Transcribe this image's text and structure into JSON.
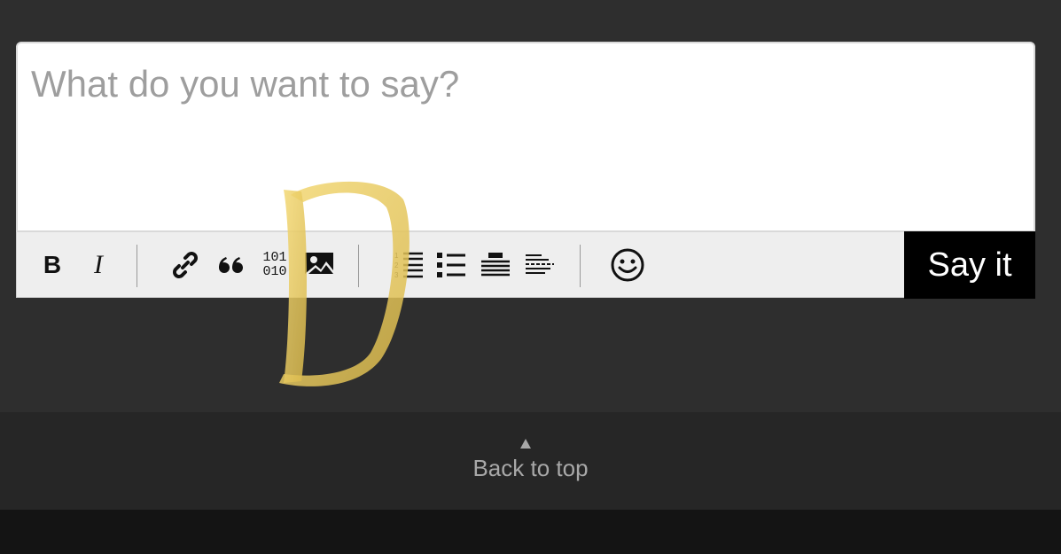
{
  "composer": {
    "placeholder": "What do you want to say?",
    "value": "",
    "submit_label": "Say it"
  },
  "toolbar": {
    "bold_glyph": "B",
    "italic_glyph": "I",
    "code_glyph_top": "101",
    "code_glyph_bottom": "010",
    "icons": [
      "bold-icon",
      "italic-icon",
      "link-icon",
      "quote-icon",
      "code-icon",
      "image-icon",
      "numbered-list-icon",
      "bullet-list-icon",
      "heading-icon",
      "horizontal-rule-icon",
      "emoji-icon"
    ]
  },
  "footer": {
    "back_to_top_label": "Back to top"
  },
  "colors": {
    "page_background": "#2e2e2e",
    "footer_background": "#262626",
    "bottom_bar": "#141414",
    "submit_background": "#000000",
    "toolbar_background": "#eeeeee",
    "watermark": "#e8c95a"
  }
}
